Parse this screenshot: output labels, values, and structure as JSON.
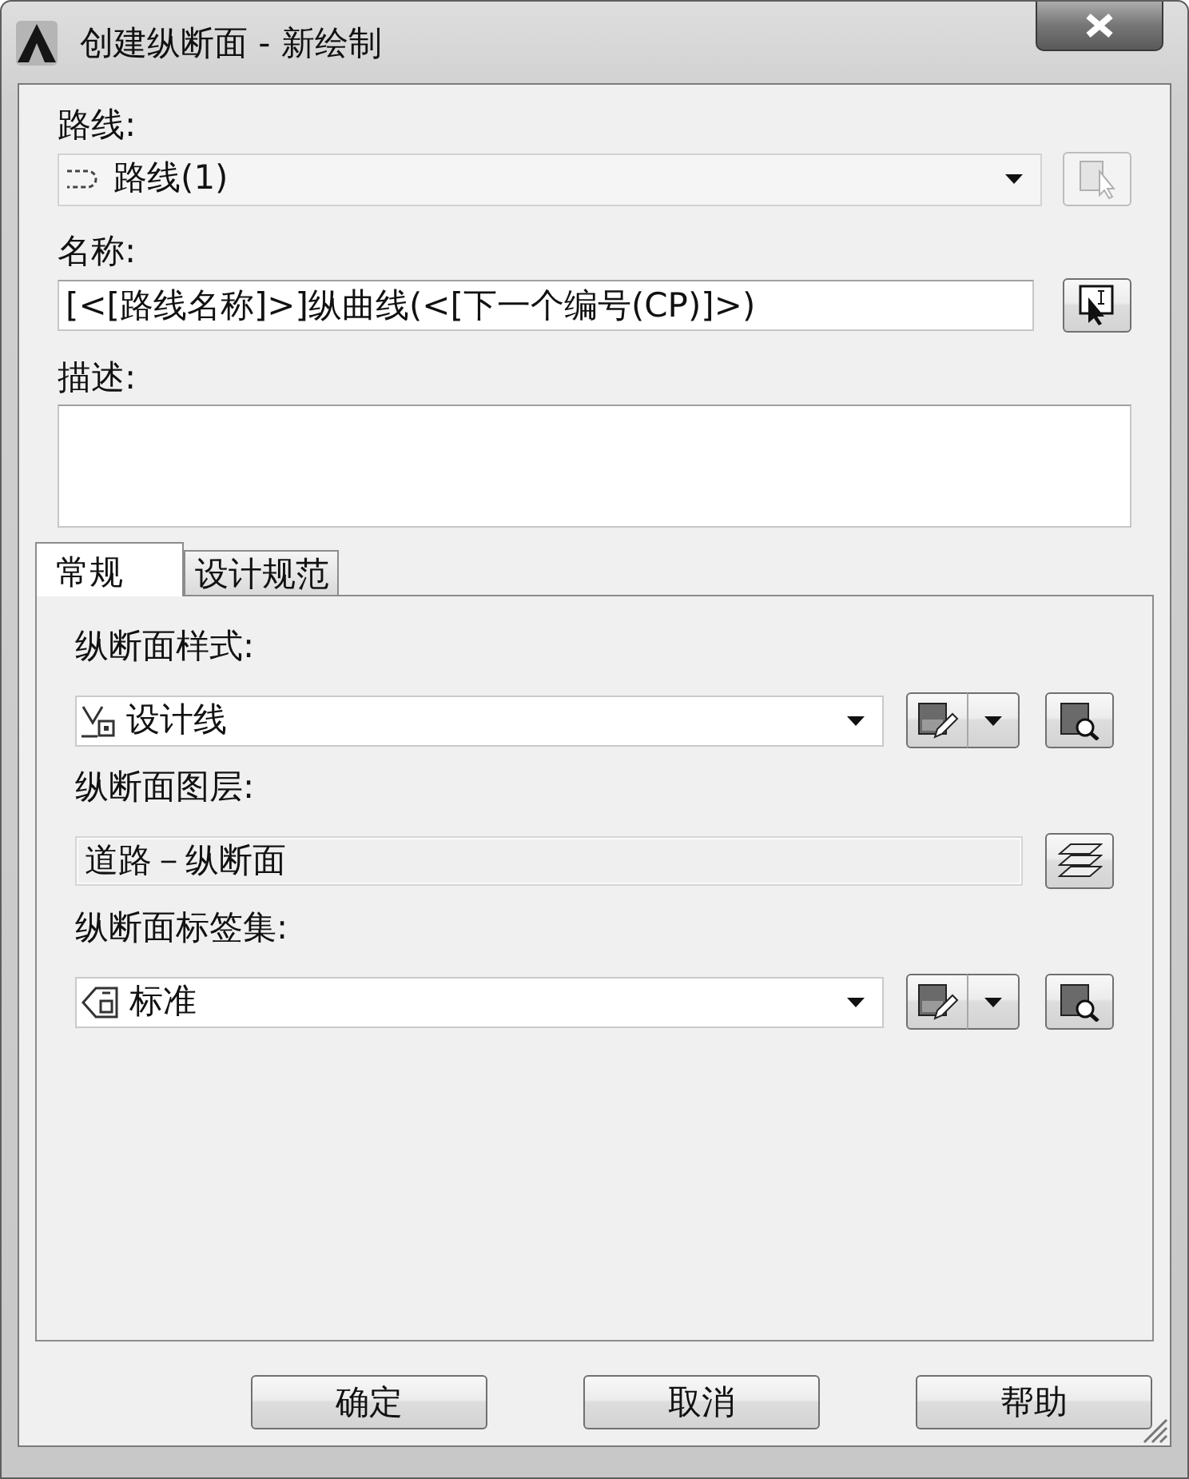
{
  "window": {
    "title": "创建纵断面 - 新绘制"
  },
  "alignment": {
    "label": "路线:",
    "value": "路线(1)",
    "disabled": true
  },
  "name": {
    "label": "名称:",
    "value": "[<[路线名称]>]纵曲线(<[下一个编号(CP)]>)"
  },
  "description": {
    "label": "描述:"
  },
  "tabs": [
    {
      "label": "常规",
      "selected": true
    },
    {
      "label": "设计规范",
      "selected": false
    }
  ],
  "fields": [
    {
      "kind": "profile-style",
      "label": "纵断面样式:",
      "value": "设计线"
    },
    {
      "kind": "layer",
      "label": "纵断面图层:",
      "value": "道路－纵断面"
    },
    {
      "kind": "label-set",
      "label": "纵断面标签集:",
      "value": "标准"
    }
  ],
  "buttons": [
    "确定",
    "取消",
    "帮助"
  ]
}
